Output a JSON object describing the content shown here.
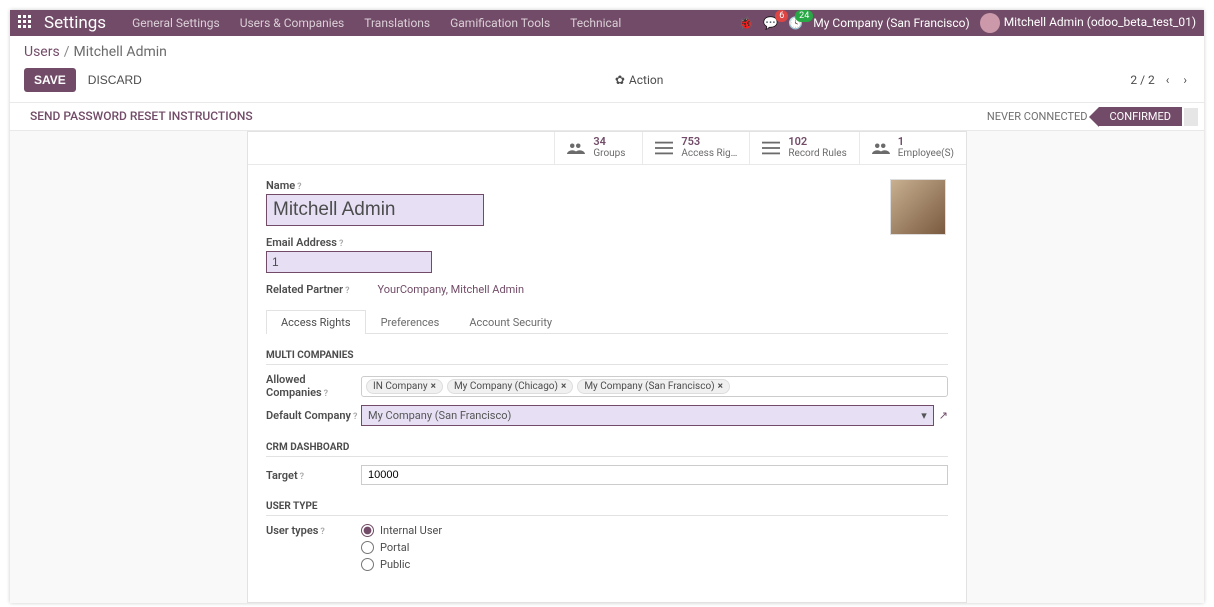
{
  "topbar": {
    "brand": "Settings",
    "menu": [
      "General Settings",
      "Users & Companies",
      "Translations",
      "Gamification Tools",
      "Technical"
    ],
    "chat_badge": "6",
    "activities_badge": "24",
    "company": "My Company (San Francisco)",
    "user": "Mitchell Admin (odoo_beta_test_01)"
  },
  "breadcrumb": {
    "root": "Users",
    "current": "Mitchell Admin"
  },
  "ctrl": {
    "save": "SAVE",
    "discard": "DISCARD",
    "action": "Action",
    "pager": "2 / 2"
  },
  "status": {
    "send": "SEND PASSWORD RESET INSTRUCTIONS",
    "never": "NEVER CONNECTED",
    "confirmed": "CONFIRMED"
  },
  "stats": [
    {
      "n": "34",
      "l": "Groups"
    },
    {
      "n": "753",
      "l": "Access Rig…"
    },
    {
      "n": "102",
      "l": "Record Rules"
    },
    {
      "n": "1",
      "l": "Employee(S)"
    }
  ],
  "form": {
    "name_label": "Name",
    "name_value": "Mitchell Admin",
    "email_label": "Email Address",
    "email_value": "1",
    "partner_label": "Related Partner",
    "partner_value": "YourCompany, Mitchell Admin"
  },
  "tabs": [
    "Access Rights",
    "Preferences",
    "Account Security"
  ],
  "sections": {
    "multi": "MULTI COMPANIES",
    "crm": "CRM DASHBOARD",
    "ut": "USER TYPE"
  },
  "multi": {
    "allowed_label": "Allowed Companies",
    "tags": [
      "IN Company",
      "My Company (Chicago)",
      "My Company (San Francisco)"
    ],
    "default_label": "Default Company",
    "default_value": "My Company (San Francisco)"
  },
  "crm": {
    "target_label": "Target",
    "target_value": "10000"
  },
  "usertype": {
    "label": "User types",
    "opts": [
      "Internal User",
      "Portal",
      "Public"
    ]
  }
}
